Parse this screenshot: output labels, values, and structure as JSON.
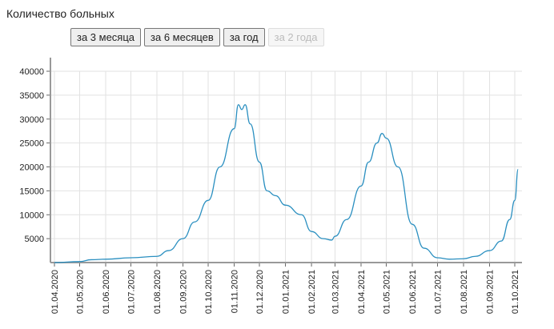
{
  "title": "Количество больных",
  "buttons": [
    {
      "label": "за 3 месяца",
      "enabled": true
    },
    {
      "label": "за 6 месяцев",
      "enabled": true
    },
    {
      "label": "за год",
      "enabled": true
    },
    {
      "label": "за 2 года",
      "enabled": false
    }
  ],
  "chart_data": {
    "type": "line",
    "title": "Количество больных",
    "ylim": [
      0,
      40000
    ],
    "yticks": [
      5000,
      10000,
      15000,
      20000,
      25000,
      30000,
      35000,
      40000
    ],
    "xticks": [
      "01.04.2020",
      "01.05.2020",
      "01.06.2020",
      "01.07.2020",
      "01.08.2020",
      "01.09.2020",
      "01.10.2020",
      "01.11.2020",
      "01.12.2020",
      "01.01.2021",
      "01.02.2021",
      "01.03.2021",
      "01.04.2021",
      "01.05.2021",
      "01.06.2021",
      "01.07.2021",
      "01.08.2021",
      "01.09.2021",
      "01.10.2021"
    ],
    "grid": true,
    "color": "#2a8fc0",
    "series": [
      {
        "name": "Количество больных",
        "points": [
          [
            "2020-04-01",
            0
          ],
          [
            "2020-05-01",
            200
          ],
          [
            "2020-05-15",
            600
          ],
          [
            "2020-06-01",
            700
          ],
          [
            "2020-07-01",
            1000
          ],
          [
            "2020-08-01",
            1300
          ],
          [
            "2020-08-15",
            2500
          ],
          [
            "2020-09-01",
            5000
          ],
          [
            "2020-09-15",
            8500
          ],
          [
            "2020-10-01",
            13000
          ],
          [
            "2020-10-15",
            20000
          ],
          [
            "2020-11-01",
            28000
          ],
          [
            "2020-11-06",
            33000
          ],
          [
            "2020-11-10",
            32000
          ],
          [
            "2020-11-14",
            33000
          ],
          [
            "2020-11-20",
            29000
          ],
          [
            "2020-12-01",
            21000
          ],
          [
            "2020-12-10",
            15000
          ],
          [
            "2020-12-20",
            14000
          ],
          [
            "2021-01-01",
            12000
          ],
          [
            "2021-01-20",
            10000
          ],
          [
            "2021-02-01",
            6500
          ],
          [
            "2021-02-15",
            5000
          ],
          [
            "2021-02-25",
            4700
          ],
          [
            "2021-03-01",
            5500
          ],
          [
            "2021-03-15",
            9000
          ],
          [
            "2021-04-01",
            16000
          ],
          [
            "2021-04-10",
            21000
          ],
          [
            "2021-04-20",
            25000
          ],
          [
            "2021-04-26",
            27000
          ],
          [
            "2021-05-01",
            26000
          ],
          [
            "2021-05-15",
            20000
          ],
          [
            "2021-06-01",
            8000
          ],
          [
            "2021-06-15",
            3000
          ],
          [
            "2021-07-01",
            1000
          ],
          [
            "2021-07-15",
            700
          ],
          [
            "2021-08-01",
            800
          ],
          [
            "2021-08-15",
            1300
          ],
          [
            "2021-09-01",
            2500
          ],
          [
            "2021-09-15",
            4500
          ],
          [
            "2021-09-25",
            9000
          ],
          [
            "2021-10-01",
            13000
          ],
          [
            "2021-10-05",
            19500
          ]
        ]
      }
    ]
  }
}
